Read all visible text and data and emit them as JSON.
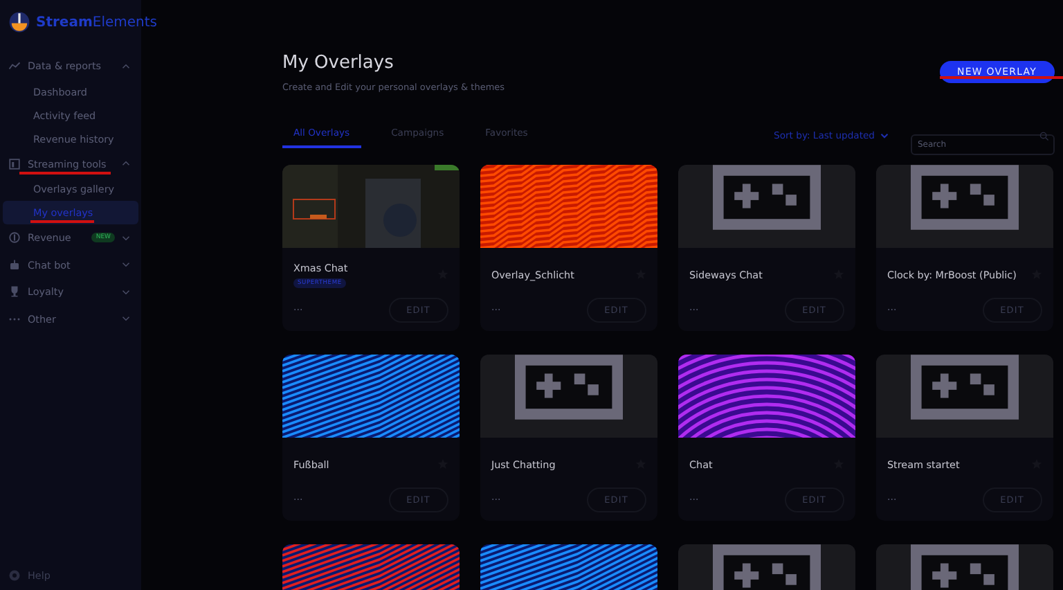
{
  "sidebar": {
    "logo": [
      "Stream",
      "Elements"
    ],
    "items": [
      {
        "label": "Data & reports",
        "expanded": true,
        "selected": false,
        "children": [
          {
            "label": "Dashboard",
            "selected": false
          },
          {
            "label": "Activity feed",
            "selected": false
          },
          {
            "label": "Revenue history",
            "selected": false
          }
        ]
      },
      {
        "label": "Streaming tools",
        "expanded": true,
        "selected": false,
        "annotated": true,
        "children": [
          {
            "label": "Overlays gallery",
            "selected": false
          },
          {
            "label": "My overlays",
            "selected": true,
            "annotated": true
          }
        ]
      },
      {
        "label": "Revenue",
        "badge": "NEW",
        "expanded": false,
        "selected": false
      },
      {
        "label": "Chat bot",
        "expanded": false,
        "selected": false
      },
      {
        "label": "Loyalty",
        "expanded": false,
        "selected": false
      },
      {
        "label": "Other",
        "expanded": false,
        "selected": false
      }
    ],
    "help": "Help"
  },
  "header": {
    "title": "My Overlays",
    "subtitle": "Create and Edit your personal overlays & themes",
    "button": "NEW OVERLAY",
    "button_annotated": true
  },
  "tabs": [
    {
      "label": "All Overlays",
      "selected": true
    },
    {
      "label": "Campaigns",
      "selected": false
    },
    {
      "label": "Favorites",
      "selected": false
    }
  ],
  "sort": {
    "label": "Sort by: Last updated"
  },
  "search": {
    "placeholder": "Search"
  },
  "overlays": [
    {
      "name": "Xmas Chat",
      "badge": "SUPERTHEME",
      "menu": "···",
      "edit": "EDIT"
    },
    {
      "name": "Overlay_Schlicht",
      "thumbnail": {
        "kind": "zigzag",
        "color": "#ff4a00"
      },
      "menu": "···",
      "edit": "EDIT"
    },
    {
      "name": "Sideways Chat",
      "thumbnail": {
        "kind": "controller"
      },
      "menu": "···",
      "edit": "EDIT"
    },
    {
      "name": "Clock by: MrBoost (Public)",
      "thumbnail": {
        "kind": "controller"
      },
      "menu": "···",
      "edit": "EDIT"
    },
    {
      "name": "Fußball",
      "thumbnail": {
        "kind": "lines",
        "color": "#1a8cff"
      },
      "menu": "···",
      "edit": "EDIT"
    },
    {
      "name": "Just Chatting",
      "thumbnail": {
        "kind": "controller"
      },
      "menu": "···",
      "edit": "EDIT"
    },
    {
      "name": "Chat",
      "thumbnail": {
        "kind": "arcs",
        "color": "#b02cf0"
      },
      "menu": "···",
      "edit": "EDIT"
    },
    {
      "name": "Stream startet",
      "thumbnail": {
        "kind": "controller"
      },
      "menu": "···",
      "edit": "EDIT"
    },
    {
      "thumbnail": {
        "kind": "lines",
        "color": "#e02020"
      }
    },
    {
      "thumbnail": {
        "kind": "lines",
        "color": "#1a8cff"
      }
    },
    {
      "thumbnail": {
        "kind": "controller"
      }
    },
    {
      "thumbnail": {
        "kind": "controller"
      }
    }
  ]
}
